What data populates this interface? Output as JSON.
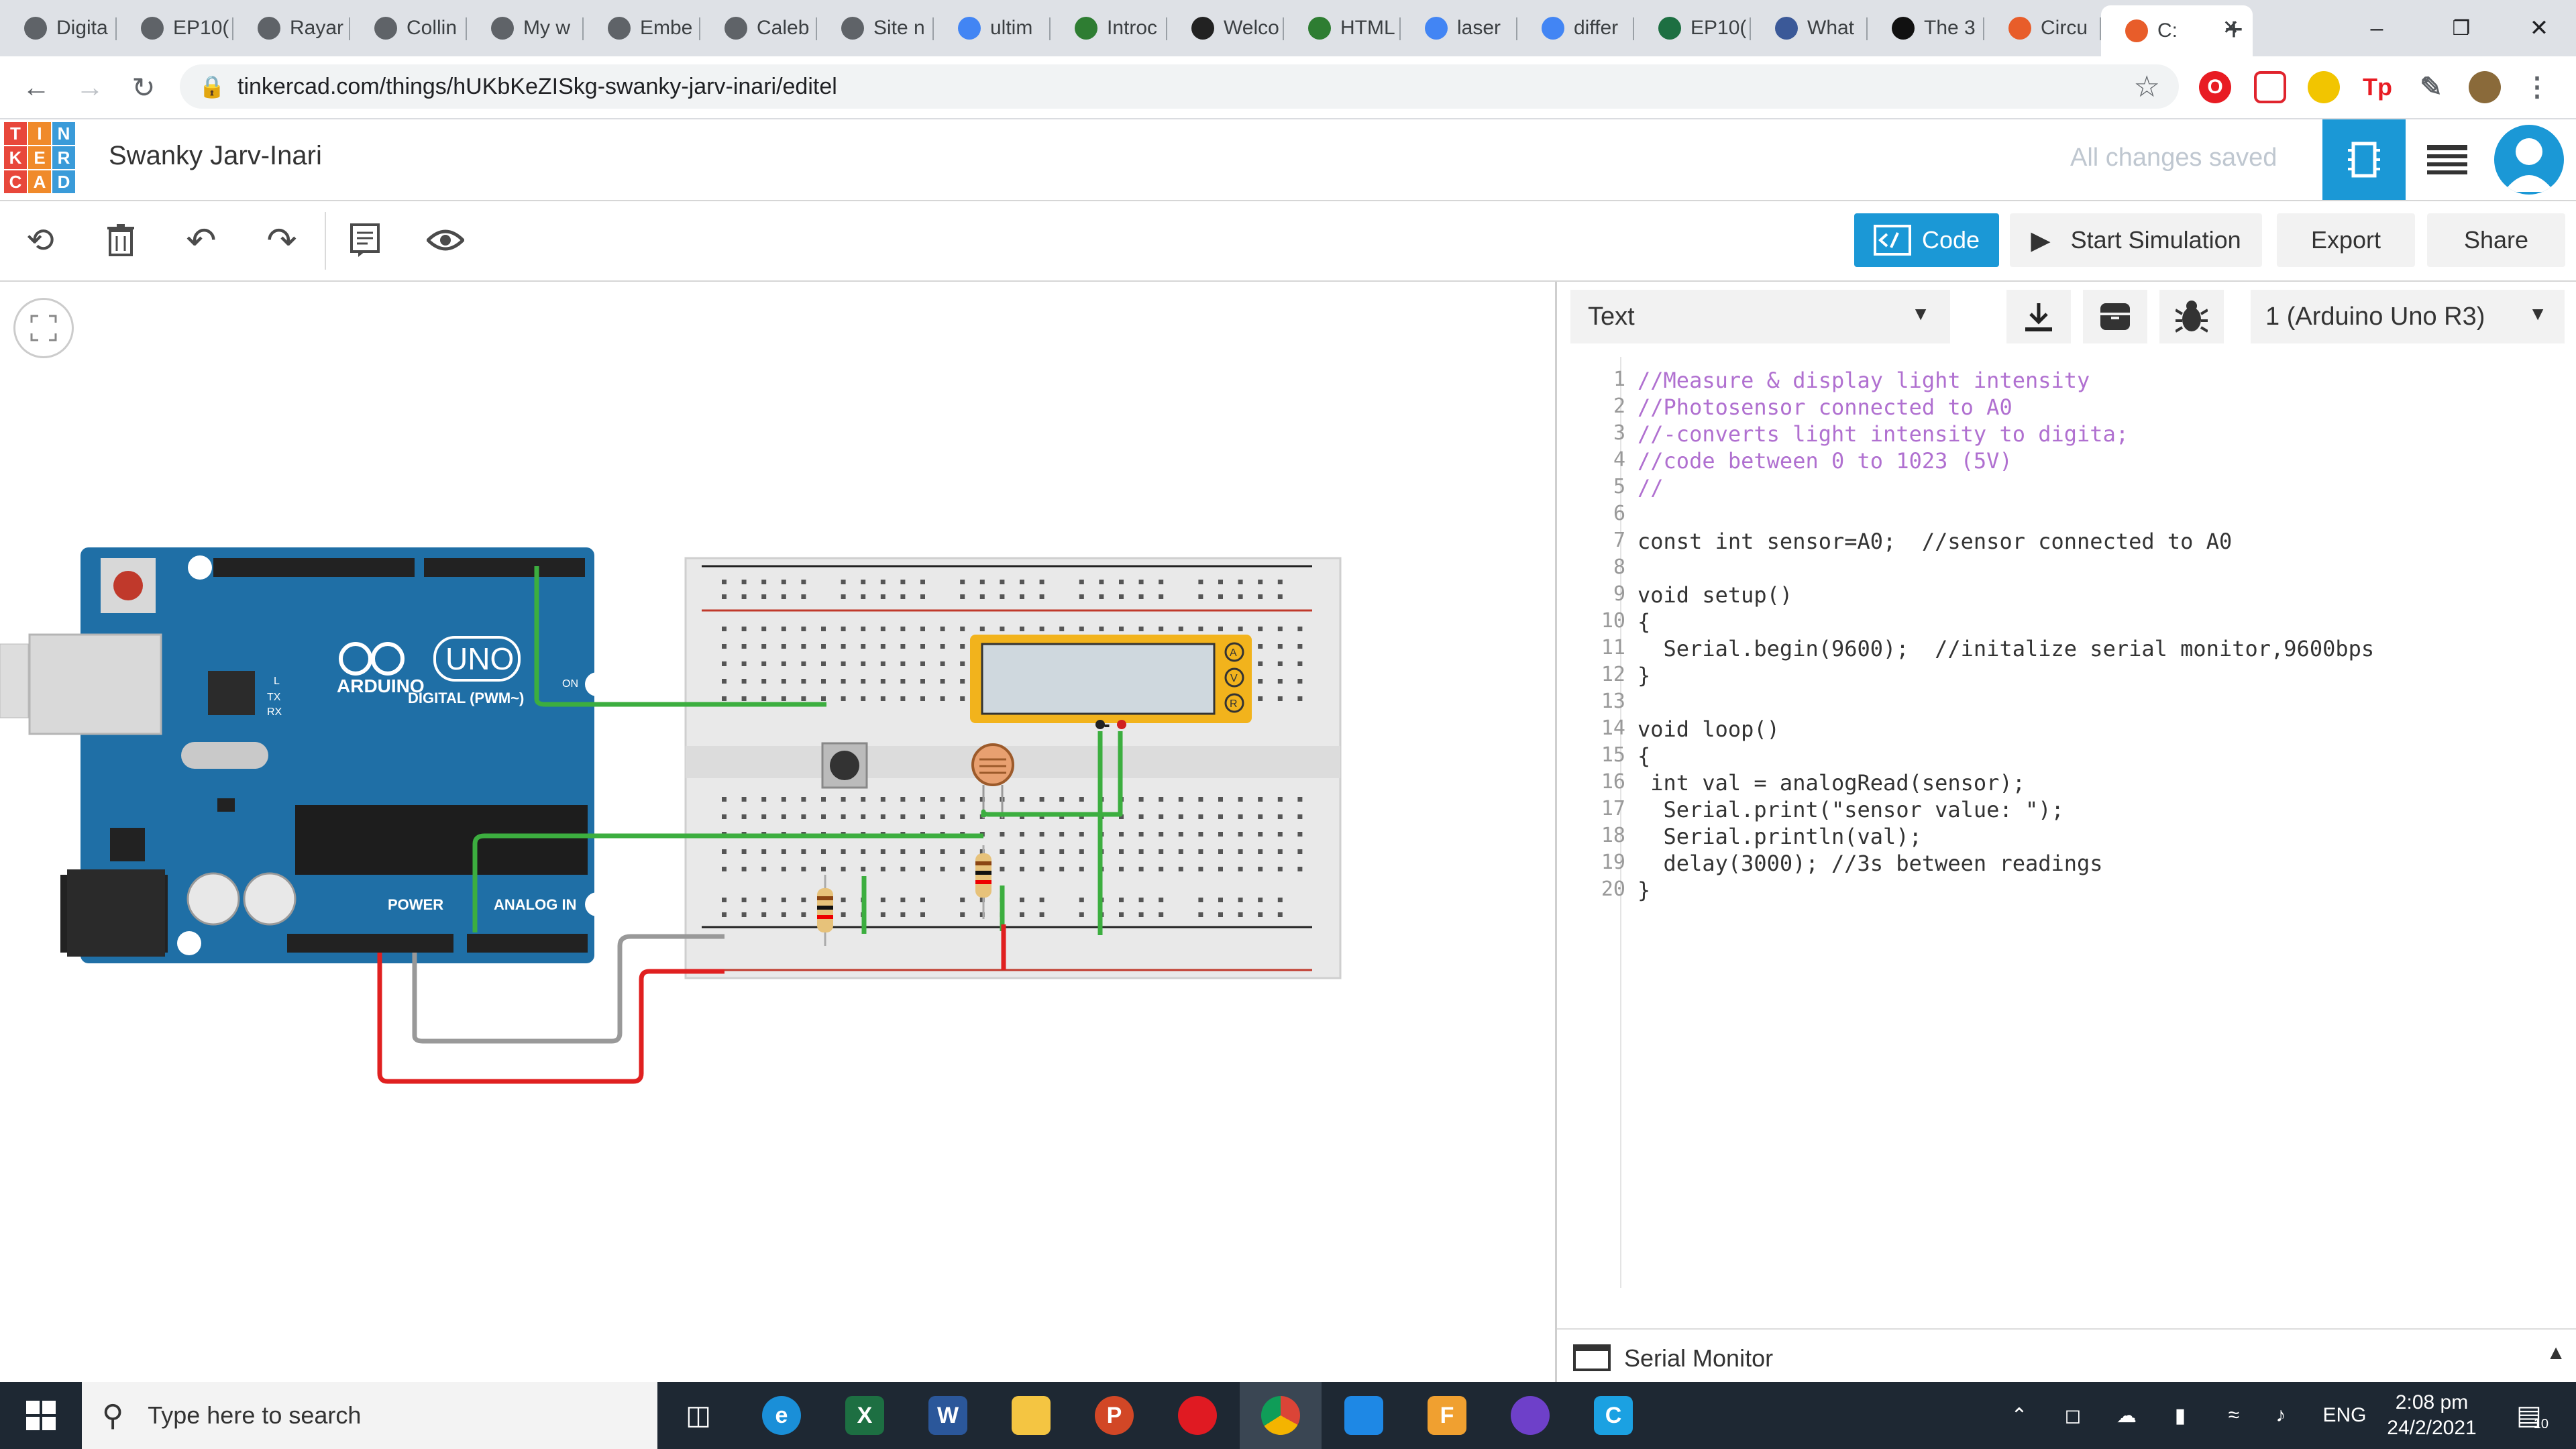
{
  "browser": {
    "tabs": [
      {
        "label": "Digita",
        "icon": "globe-icon",
        "color": "#5f6368"
      },
      {
        "label": "EP10(",
        "icon": "globe-icon",
        "color": "#5f6368"
      },
      {
        "label": "Rayar",
        "icon": "globe-icon",
        "color": "#5f6368"
      },
      {
        "label": "Collin",
        "icon": "globe-icon",
        "color": "#5f6368"
      },
      {
        "label": "My w",
        "icon": "globe-icon",
        "color": "#5f6368"
      },
      {
        "label": "Embe",
        "icon": "globe-icon",
        "color": "#5f6368"
      },
      {
        "label": "Caleb",
        "icon": "globe-icon",
        "color": "#5f6368"
      },
      {
        "label": "Site n",
        "icon": "globe-icon",
        "color": "#5f6368"
      },
      {
        "label": "ultim",
        "icon": "google-icon",
        "color": "#4285f4"
      },
      {
        "label": "Introc",
        "icon": "w-icon",
        "color": "#2e7d32"
      },
      {
        "label": "Welco",
        "icon": "blackboard-icon",
        "color": "#222222"
      },
      {
        "label": "HTML",
        "icon": "w-icon",
        "color": "#2e7d32"
      },
      {
        "label": "laser",
        "icon": "google-icon",
        "color": "#4285f4"
      },
      {
        "label": "differ",
        "icon": "google-icon",
        "color": "#4285f4"
      },
      {
        "label": "EP10(",
        "icon": "excel-icon",
        "color": "#1d6f42"
      },
      {
        "label": "What",
        "icon": "tw-icon",
        "color": "#3b5998"
      },
      {
        "label": "The 3",
        "icon": "a-icon",
        "color": "#111111"
      },
      {
        "label": "Circu",
        "icon": "tinkercad-icon",
        "color": "#e85d2a"
      },
      {
        "label": "C:",
        "icon": "tinkercad-icon",
        "color": "#e85d2a"
      }
    ],
    "new_tab": "+",
    "url": "tinkercad.com/things/hUKbKeZISkg-swanky-jarv-inari/editel",
    "ext_labels": [
      "O",
      "",
      "",
      "Tp",
      "",
      ""
    ]
  },
  "app": {
    "logo_letters": [
      "T",
      "I",
      "N",
      "K",
      "E",
      "R",
      "C",
      "A",
      "D"
    ],
    "logo_colors": [
      "#e8473b",
      "#f08a2a",
      "#3a9bd9",
      "#e8473b",
      "#f08a2a",
      "#3a9bd9",
      "#e8473b",
      "#f08a2a",
      "#3a9bd9"
    ],
    "project_title": "Swanky Jarv-Inari",
    "save_status": "All changes saved",
    "accent": "#1b98d6"
  },
  "toolbar": {
    "code_label": "Code",
    "start_sim_label": "Start Simulation",
    "export_label": "Export",
    "share_label": "Share"
  },
  "code_panel": {
    "mode": "Text",
    "device": "1 (Arduino Uno R3)",
    "serial_monitor": "Serial Monitor",
    "lines": [
      {
        "n": "1"
      },
      {
        "n": "2"
      },
      {
        "n": "3"
      },
      {
        "n": "4"
      },
      {
        "n": "5"
      },
      {
        "n": "6"
      },
      {
        "n": "7"
      },
      {
        "n": "8"
      },
      {
        "n": "9"
      },
      {
        "n": "10"
      },
      {
        "n": "11"
      },
      {
        "n": "12"
      },
      {
        "n": "13"
      },
      {
        "n": "14"
      },
      {
        "n": "15"
      },
      {
        "n": "16"
      },
      {
        "n": "17"
      },
      {
        "n": "18"
      },
      {
        "n": "19"
      },
      {
        "n": "20"
      }
    ],
    "code": [
      "//Measure & display light intensity",
      "//Photosensor connected to A0",
      "//-converts light intensity to digita;",
      "//code between 0 to 1023 (5V)",
      "//",
      "",
      "const int sensor=A0;  //sensor connected to A0",
      "",
      "void setup()",
      "{",
      "  Serial.begin(9600);  //initalize serial monitor,9600bps",
      "}",
      "",
      "void loop()",
      "{",
      " int val = analogRead(sensor);",
      "  Serial.print(\"sensor value: \");",
      "  Serial.println(val);",
      "  delay(3000); //3s between readings",
      "}"
    ]
  },
  "circuit": {
    "board_brand": "ARDUINO",
    "board_model": "UNO",
    "digital_label": "DIGITAL (PWM~)",
    "analog_label": "ANALOG IN",
    "power_label": "POWER",
    "on_label": "ON",
    "tx_label": "TX",
    "rx_label": "RX",
    "l_label": "L",
    "lcd_pins": [
      "A",
      "V",
      "R"
    ]
  },
  "taskbar": {
    "search_placeholder": "Type here to search",
    "time": "2:08 pm",
    "date": "24/2/2021",
    "lang": "ENG",
    "notif_count": "10"
  }
}
